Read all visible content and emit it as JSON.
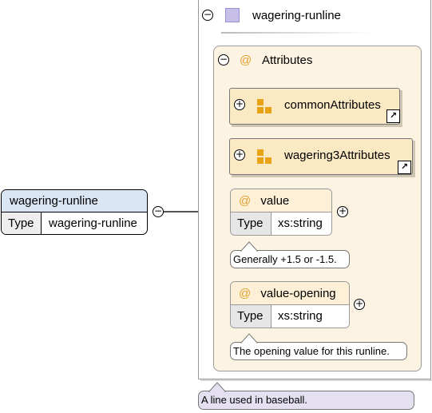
{
  "element": {
    "name": "wagering-runline",
    "type_key": "Type",
    "type_value": "wagering-runline"
  },
  "complex_type": {
    "title": "wagering-runline",
    "documentation": "A line used in baseball."
  },
  "attributes_group": {
    "title": "Attributes",
    "at_symbol": "@",
    "group_refs": [
      {
        "name": "commonAttributes"
      },
      {
        "name": "wagering3Attributes"
      }
    ],
    "attributes": [
      {
        "name": "value",
        "type_key": "Type",
        "type_value": "xs:string",
        "note": "Generally +1.5 or -1.5."
      },
      {
        "name": "value-opening",
        "type_key": "Type",
        "type_value": "xs:string",
        "note": "The opening value for this runline."
      }
    ]
  },
  "icons": {
    "collapse": "minus-circle-icon",
    "expand": "plus-circle-icon",
    "complex_type": "purple-square-icon",
    "attribute_group": "orange-squares-icon",
    "link": "link-arrow-icon"
  },
  "colors": {
    "element_header": "#dbe6f5",
    "attribute_bg": "#fdf3e3",
    "group_ref_bg": "#fbe9c4",
    "note_bg": "#e5e0f0",
    "type_icon": "#c8bfe8"
  }
}
